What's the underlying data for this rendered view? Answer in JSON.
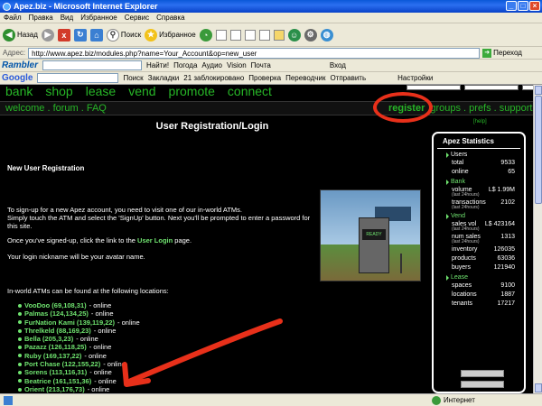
{
  "window": {
    "title": "Apez.biz - Microsoft Internet Explorer"
  },
  "menu": [
    "Файл",
    "Правка",
    "Вид",
    "Избранное",
    "Сервис",
    "Справка"
  ],
  "toolbar": {
    "back": "Назад",
    "search": "Поиск",
    "favorites": "Избранное"
  },
  "address": {
    "label": "Адрес:",
    "url": "http://www.apez.biz/modules.php?name=Your_Account&op=new_user",
    "go": "Переход"
  },
  "rambler": {
    "logo": "Rambler",
    "find": "Найти!",
    "weather": "Погода",
    "audio": "Аудио",
    "vision": "Vision",
    "mail": "Почта",
    "login": "Вход"
  },
  "google": {
    "logo": "Google",
    "search": "Поиск",
    "bookmarks": "Закладки",
    "blocked": "21 заблокировано",
    "check": "Проверка",
    "translate": "Переводчик",
    "send": "Отправить",
    "settings": "Настройки"
  },
  "site": {
    "nav_top": [
      "bank",
      "shop",
      "lease",
      "vend",
      "promote",
      "connect"
    ],
    "nav_left": "welcome . forum . FAQ",
    "nav_register": "register",
    "nav_right": "groups . prefs . support",
    "help": "[help]",
    "page_title": "User Registration/Login",
    "section_title": "New User Registration",
    "p1": "To sign-up for a new Apez account, you need to visit one of our in-world ATMs.",
    "p2": "Simply touch the ATM and select the 'SignUp' button. Next you'll be prompted to enter a password for this site.",
    "p3_pre": "Once you've signed-up, click the link to the",
    "p3_link": "User Login",
    "p3_post": "page.",
    "p4": "Your login nickname will be your avatar name.",
    "p5": "In-world ATMs can be found at the following locations:",
    "atm_screen": "READY",
    "locations": [
      {
        "name": "VooDoo (69,108,31)",
        "status": " - online"
      },
      {
        "name": "Palmas (124,134,25)",
        "status": " - online"
      },
      {
        "name": "FurNation Kami (139,119,22)",
        "status": " - online"
      },
      {
        "name": "Threlkeld (88,169,23)",
        "status": " - online"
      },
      {
        "name": "Bella (205,3,23)",
        "status": " - online"
      },
      {
        "name": "Pazazz (126,118,25)",
        "status": " - online"
      },
      {
        "name": "Ruby (169,137,22)",
        "status": " - online"
      },
      {
        "name": "Port Chase (122,155,22)",
        "status": " - online"
      },
      {
        "name": "Sorens (113,116,31)",
        "status": " - online"
      },
      {
        "name": "Beatrice (161,151,36)",
        "status": " - online"
      },
      {
        "name": "Orient (213,176,73)",
        "status": " - online"
      }
    ]
  },
  "stats": {
    "title": "Apez Statistics",
    "users_label": "Users",
    "users": [
      {
        "k": "total",
        "v": "9533"
      },
      {
        "k": "online",
        "v": "65"
      }
    ],
    "bank_label": "Bank",
    "bank": [
      {
        "k": "volume",
        "v": "L$ 1.99M",
        "sub": "(last 24hours)"
      },
      {
        "k": "transactions",
        "v": "2102",
        "sub": "(last 24hours)"
      }
    ],
    "vend_label": "Vend",
    "vend": [
      {
        "k": "sales vol",
        "v": "L$ 423164",
        "sub": "(last 24hours)"
      },
      {
        "k": "num sales",
        "v": "1313",
        "sub": "(last 24hours)"
      },
      {
        "k": "inventory",
        "v": "126035"
      },
      {
        "k": "products",
        "v": "63036"
      },
      {
        "k": "buyers",
        "v": "121940"
      }
    ],
    "lease_label": "Lease",
    "lease": [
      {
        "k": "spaces",
        "v": "9100"
      },
      {
        "k": "locations",
        "v": "1887"
      },
      {
        "k": "tenants",
        "v": "17217"
      }
    ]
  },
  "status": {
    "zone": "Интернет"
  }
}
